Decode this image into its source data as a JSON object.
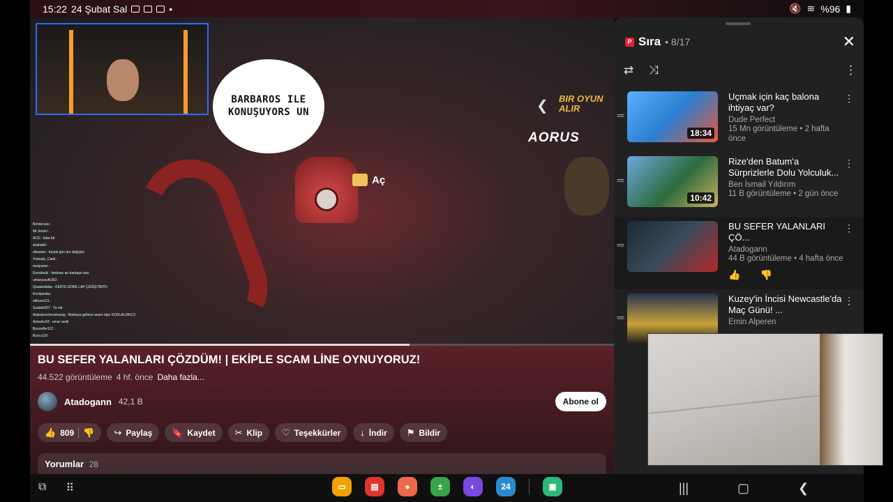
{
  "status_bar": {
    "time": "15:22",
    "date": "24 Şubat Sal",
    "battery": "%96"
  },
  "video": {
    "speech_bubble": "BARBAROS ILE KONUŞUYORS UN",
    "prompt_label": "Aç",
    "ad_text": "BIR OYUN ALIR",
    "ad_brand": "AORUS",
    "chat_lines": [
      "Bordocuks :",
      "Mr.Saniel :",
      "ACD : bata bit",
      "shahdell :",
      "efwaoke : büyük gün dur değişiyo",
      "Yumady_Cank :",
      "mssparan :",
      "Erendeski : fanboso ae barbaşo ana",
      "umaryusufk363 :",
      "Quulandidas : KEİFİS GÖBE LAP ÇEĞİŞTİRPO",
      "Krizilyankiu :",
      "alibuen111 :",
      "Sudakii007 : Yo mk",
      "Atakalcixchessbusag : Barbaya gelince anam diye KODLALDIKLO",
      "Asmahc93 : umur verdi",
      "Bozsoffer112 :",
      "Burcu118 :"
    ]
  },
  "details": {
    "title": "BU SEFER YALANLARI ÇÖZDÜM! | EKİPLE SCAM LİNE OYNUYORUZ!",
    "views": "44.522 görüntüleme",
    "age": "4 hf. önce",
    "more": "Daha fazla...",
    "channel_name": "Atadogann",
    "subscribers": "42,1 B",
    "subscribe": "Abone ol",
    "like_count": "809",
    "share": "Paylaş",
    "save": "Kaydet",
    "clip": "Klip",
    "thanks": "Teşekkürler",
    "download": "İndir",
    "report": "Bildir",
    "comments_label": "Yorumlar",
    "comments_count": "28"
  },
  "queue": {
    "badge": "P",
    "title": "Sıra",
    "position": "• 8/17",
    "items": [
      {
        "title": "Uçmak için kaç balona ihtiyaç var?",
        "channel": "Dude Perfect",
        "stats": "15 Mn görüntüleme • 2 hafta önce",
        "duration": "18:34",
        "thumb_color": "#3f8fd0"
      },
      {
        "title": "Rize'den Batum'a Sürprizlerle Dolu Yolculuk...",
        "channel": "Ben İsmail Yıldırım",
        "stats": "11 B görüntüleme • 2 gün önce",
        "duration": "10:42",
        "thumb_color": "#2e6b3c"
      },
      {
        "title": "BU SEFER YALANLARI ÇÖ...",
        "channel": "Atadogann",
        "stats": "44 B görüntüleme • 4 hafta önce",
        "duration": "",
        "thumb_color": "#2a3a4a"
      },
      {
        "title": "Kuzey'in İncisi Newcastle'da Maç Günü! ...",
        "channel": "Emin Alperen",
        "stats": "",
        "duration": "",
        "thumb_color": "#c9a23a"
      }
    ]
  },
  "navbar": {
    "calendar_day": "24"
  },
  "colors": {
    "accent_red": "#e0233a",
    "queue_bg": "#212121",
    "details_bg": "#5a2027"
  }
}
